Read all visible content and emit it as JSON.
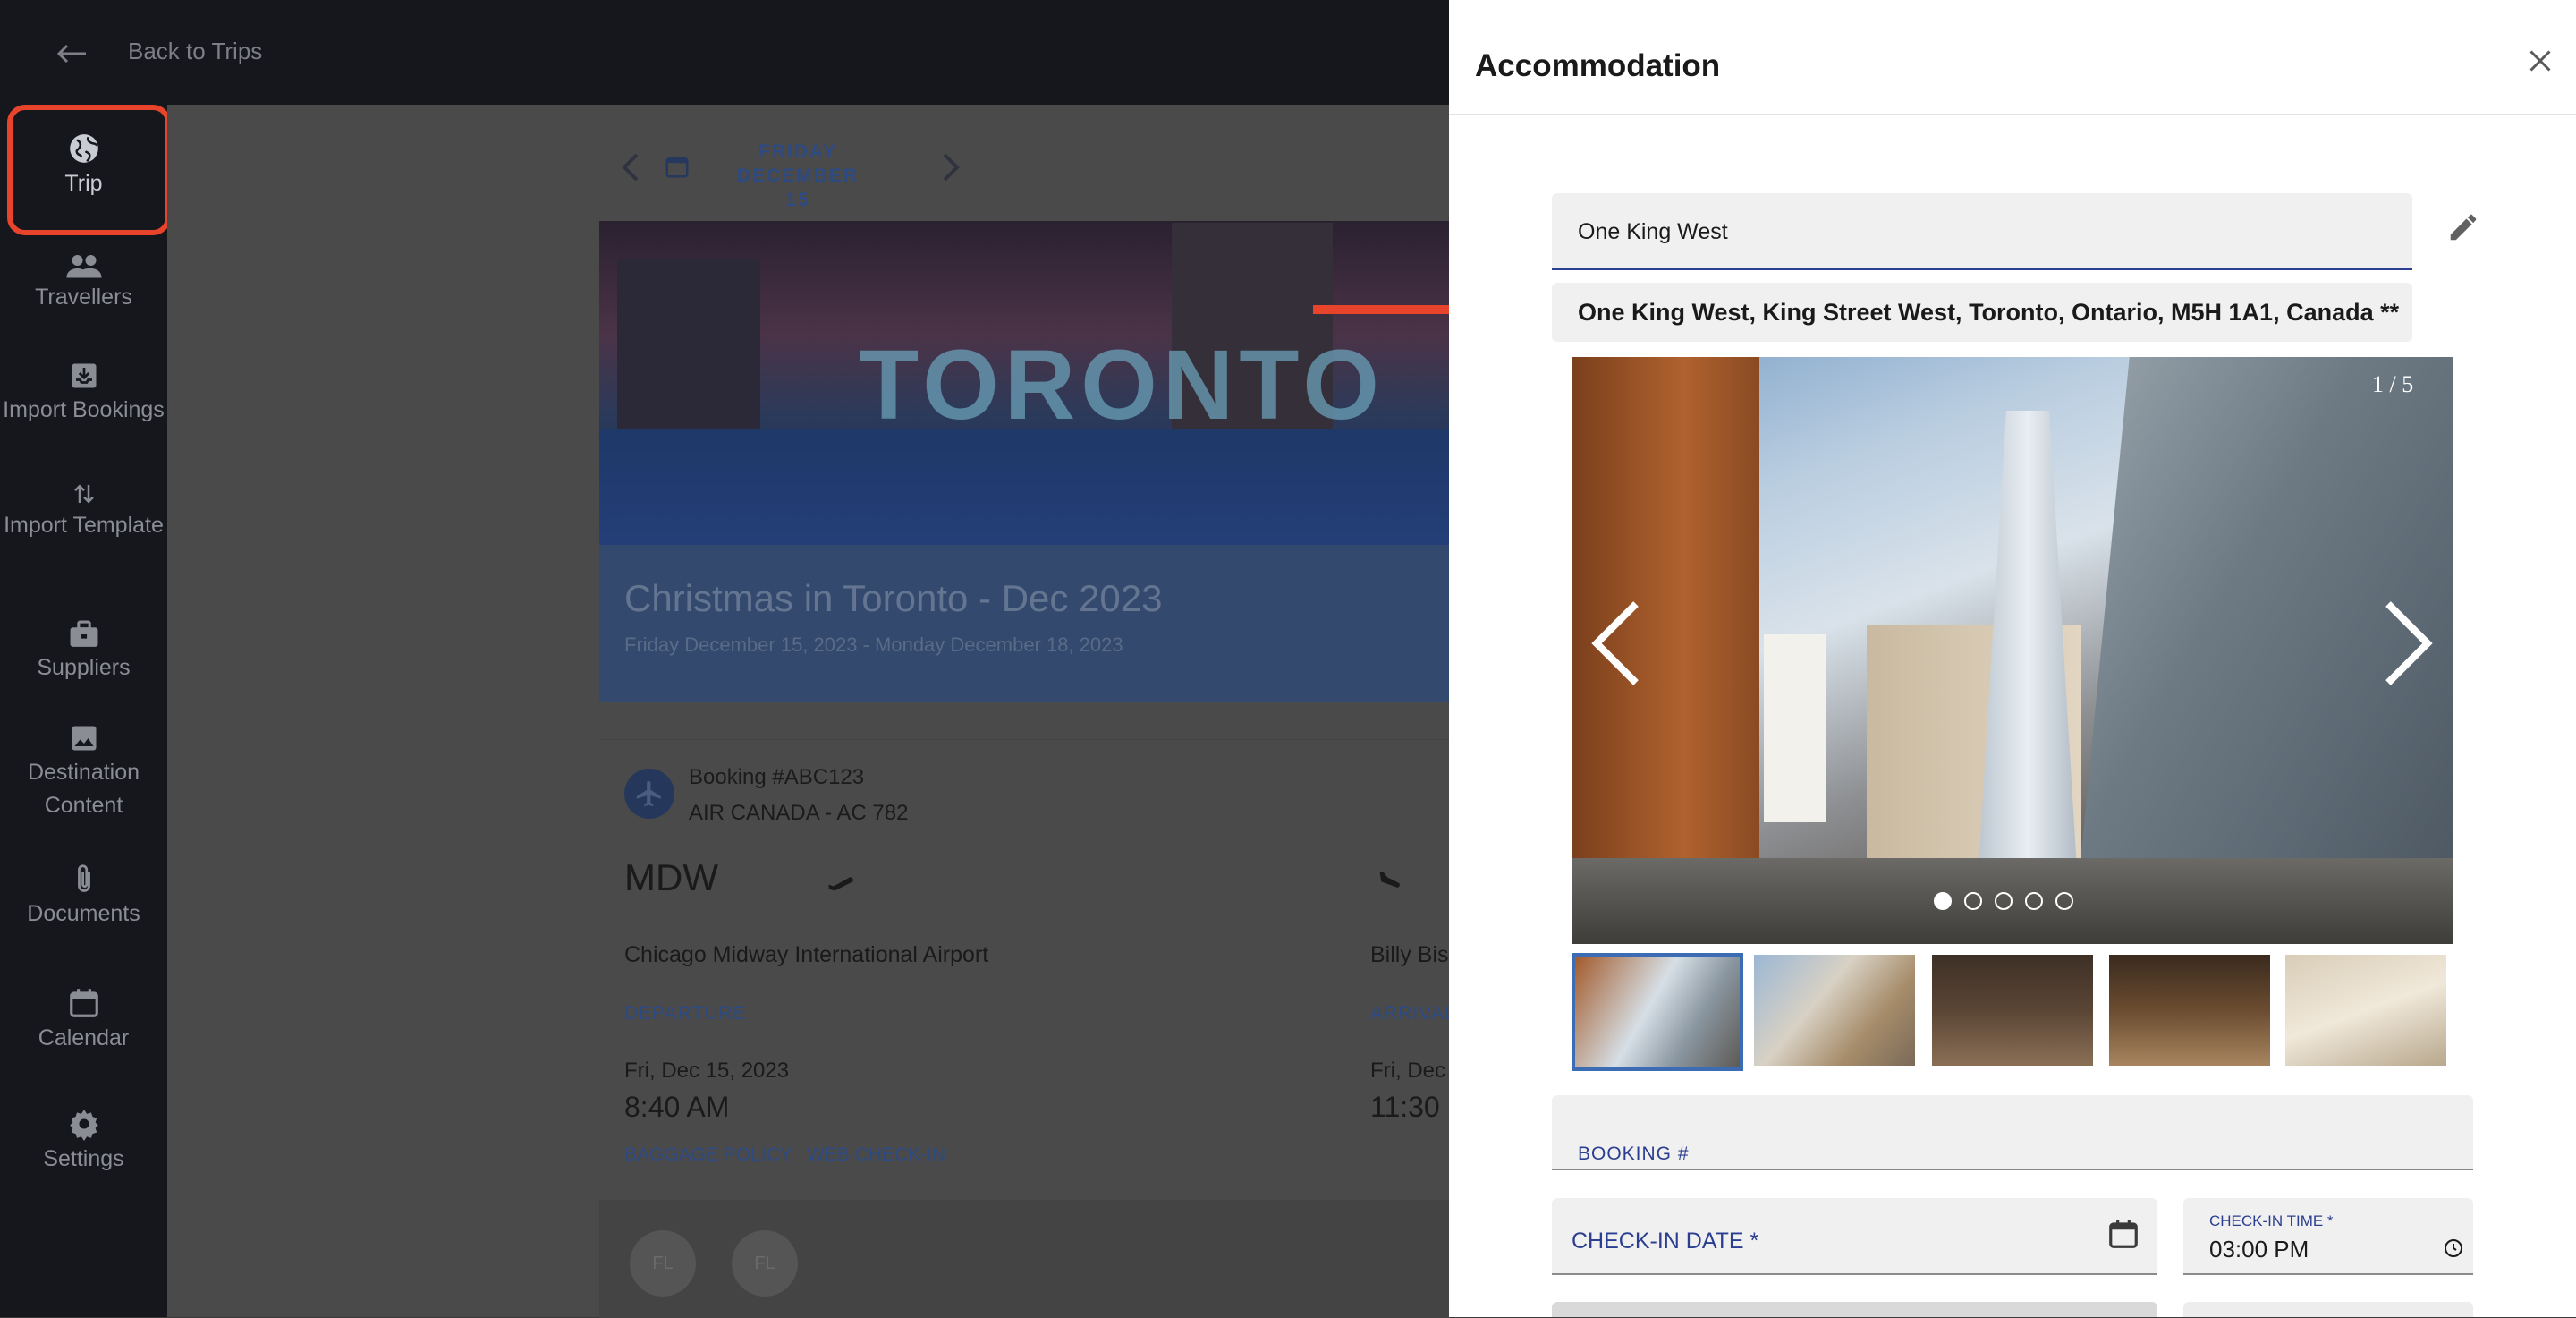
{
  "topbar": {
    "back_label": "Back to Trips"
  },
  "sidebar": {
    "items": [
      {
        "label": "Trip",
        "icon": "globe-icon",
        "active": true
      },
      {
        "label": "Travellers",
        "icon": "people-icon"
      },
      {
        "label": "Import Bookings",
        "icon": "download-tray-icon"
      },
      {
        "label": "Import Template",
        "icon": "swap-vertical-icon"
      },
      {
        "label": "Suppliers",
        "icon": "briefcase-icon"
      },
      {
        "label": "Destination Content",
        "icon": "image-icon"
      },
      {
        "label": "Documents",
        "icon": "paperclip-icon"
      },
      {
        "label": "Calendar",
        "icon": "calendar-icon"
      },
      {
        "label": "Settings",
        "icon": "gear-icon"
      }
    ]
  },
  "main": {
    "date_line1": "FRIDAY DECEMBER",
    "date_line2": "15",
    "hero_word": "TORONTO",
    "trip_title": "Christmas in Toronto - Dec 2023",
    "trip_dates": "Friday December 15, 2023 - Monday December 18, 2023",
    "booking": {
      "number": "Booking #ABC123",
      "airline": "AIR CANADA - AC 782",
      "dep_code": "MDW",
      "dep_airport": "Chicago Midway International Airport",
      "arr_airport": "Billy Bis",
      "dep_label": "DEPARTURE",
      "arr_label": "ARRIVAL",
      "dep_date": "Fri, Dec 15, 2023",
      "arr_date": "Fri, Dec",
      "dep_time": "8:40 AM",
      "arr_time": "11:30",
      "link_baggage": "BAGGAGE POLICY",
      "link_checkin": "WEB CHECK-IN",
      "avatars": [
        "FL",
        "FL"
      ]
    }
  },
  "panel": {
    "title": "Accommodation",
    "name_value": "One King West",
    "address_value": "One King West, King Street West, Toronto, Ontario, M5H 1A1, Canada **",
    "carousel": {
      "counter": "1 / 5",
      "total": 5,
      "current": 1
    },
    "booking_label": "BOOKING #",
    "checkin_date_label": "CHECK-IN DATE *",
    "checkin_time_label": "CHECK-IN TIME *",
    "checkin_time_value": "03:00 PM"
  },
  "colors": {
    "accent": "#2b3e8f",
    "highlight": "#e8442c",
    "sidebar_bg": "#16171c"
  }
}
